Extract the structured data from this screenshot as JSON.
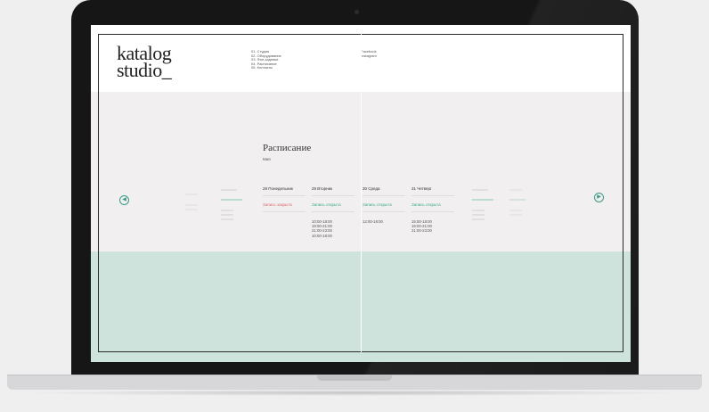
{
  "logo": {
    "line1": "katalog",
    "line2": "studio_"
  },
  "nav": [
    "01. Студия",
    "02. Оборудование",
    "03. Фон-задники",
    "04. Расписание",
    "05. Контакты"
  ],
  "social": [
    "Facebook",
    "Instagram"
  ],
  "schedule": {
    "title": "Расписание",
    "month": "Мая",
    "prev_icon": "arrow-left-circle-icon",
    "next_icon": "arrow-right-circle-icon",
    "days": [
      {
        "date": "28 Понедельник",
        "status": "Запись закрыта",
        "state": "closed",
        "times": []
      },
      {
        "date": "29 Вторник",
        "status": "Запись открыта",
        "state": "open",
        "times": [
          "10:00-18:00",
          "19:00-21:00",
          "21:00-23:00",
          "10:00-18:00"
        ]
      },
      {
        "date": "30 Среда",
        "status": "Запись открыта",
        "state": "open",
        "times": [
          "12:00-18:00"
        ]
      },
      {
        "date": "31 Четверг",
        "status": "Запись открыта",
        "state": "open",
        "times": [
          "15:00-18:00",
          "19:00-21:00",
          "21:00-23:00"
        ]
      }
    ]
  },
  "colors": {
    "accent": "#3ea88c",
    "closed": "#dd6a6a",
    "footer_bg": "#cde3db",
    "bezel": "#161616"
  }
}
